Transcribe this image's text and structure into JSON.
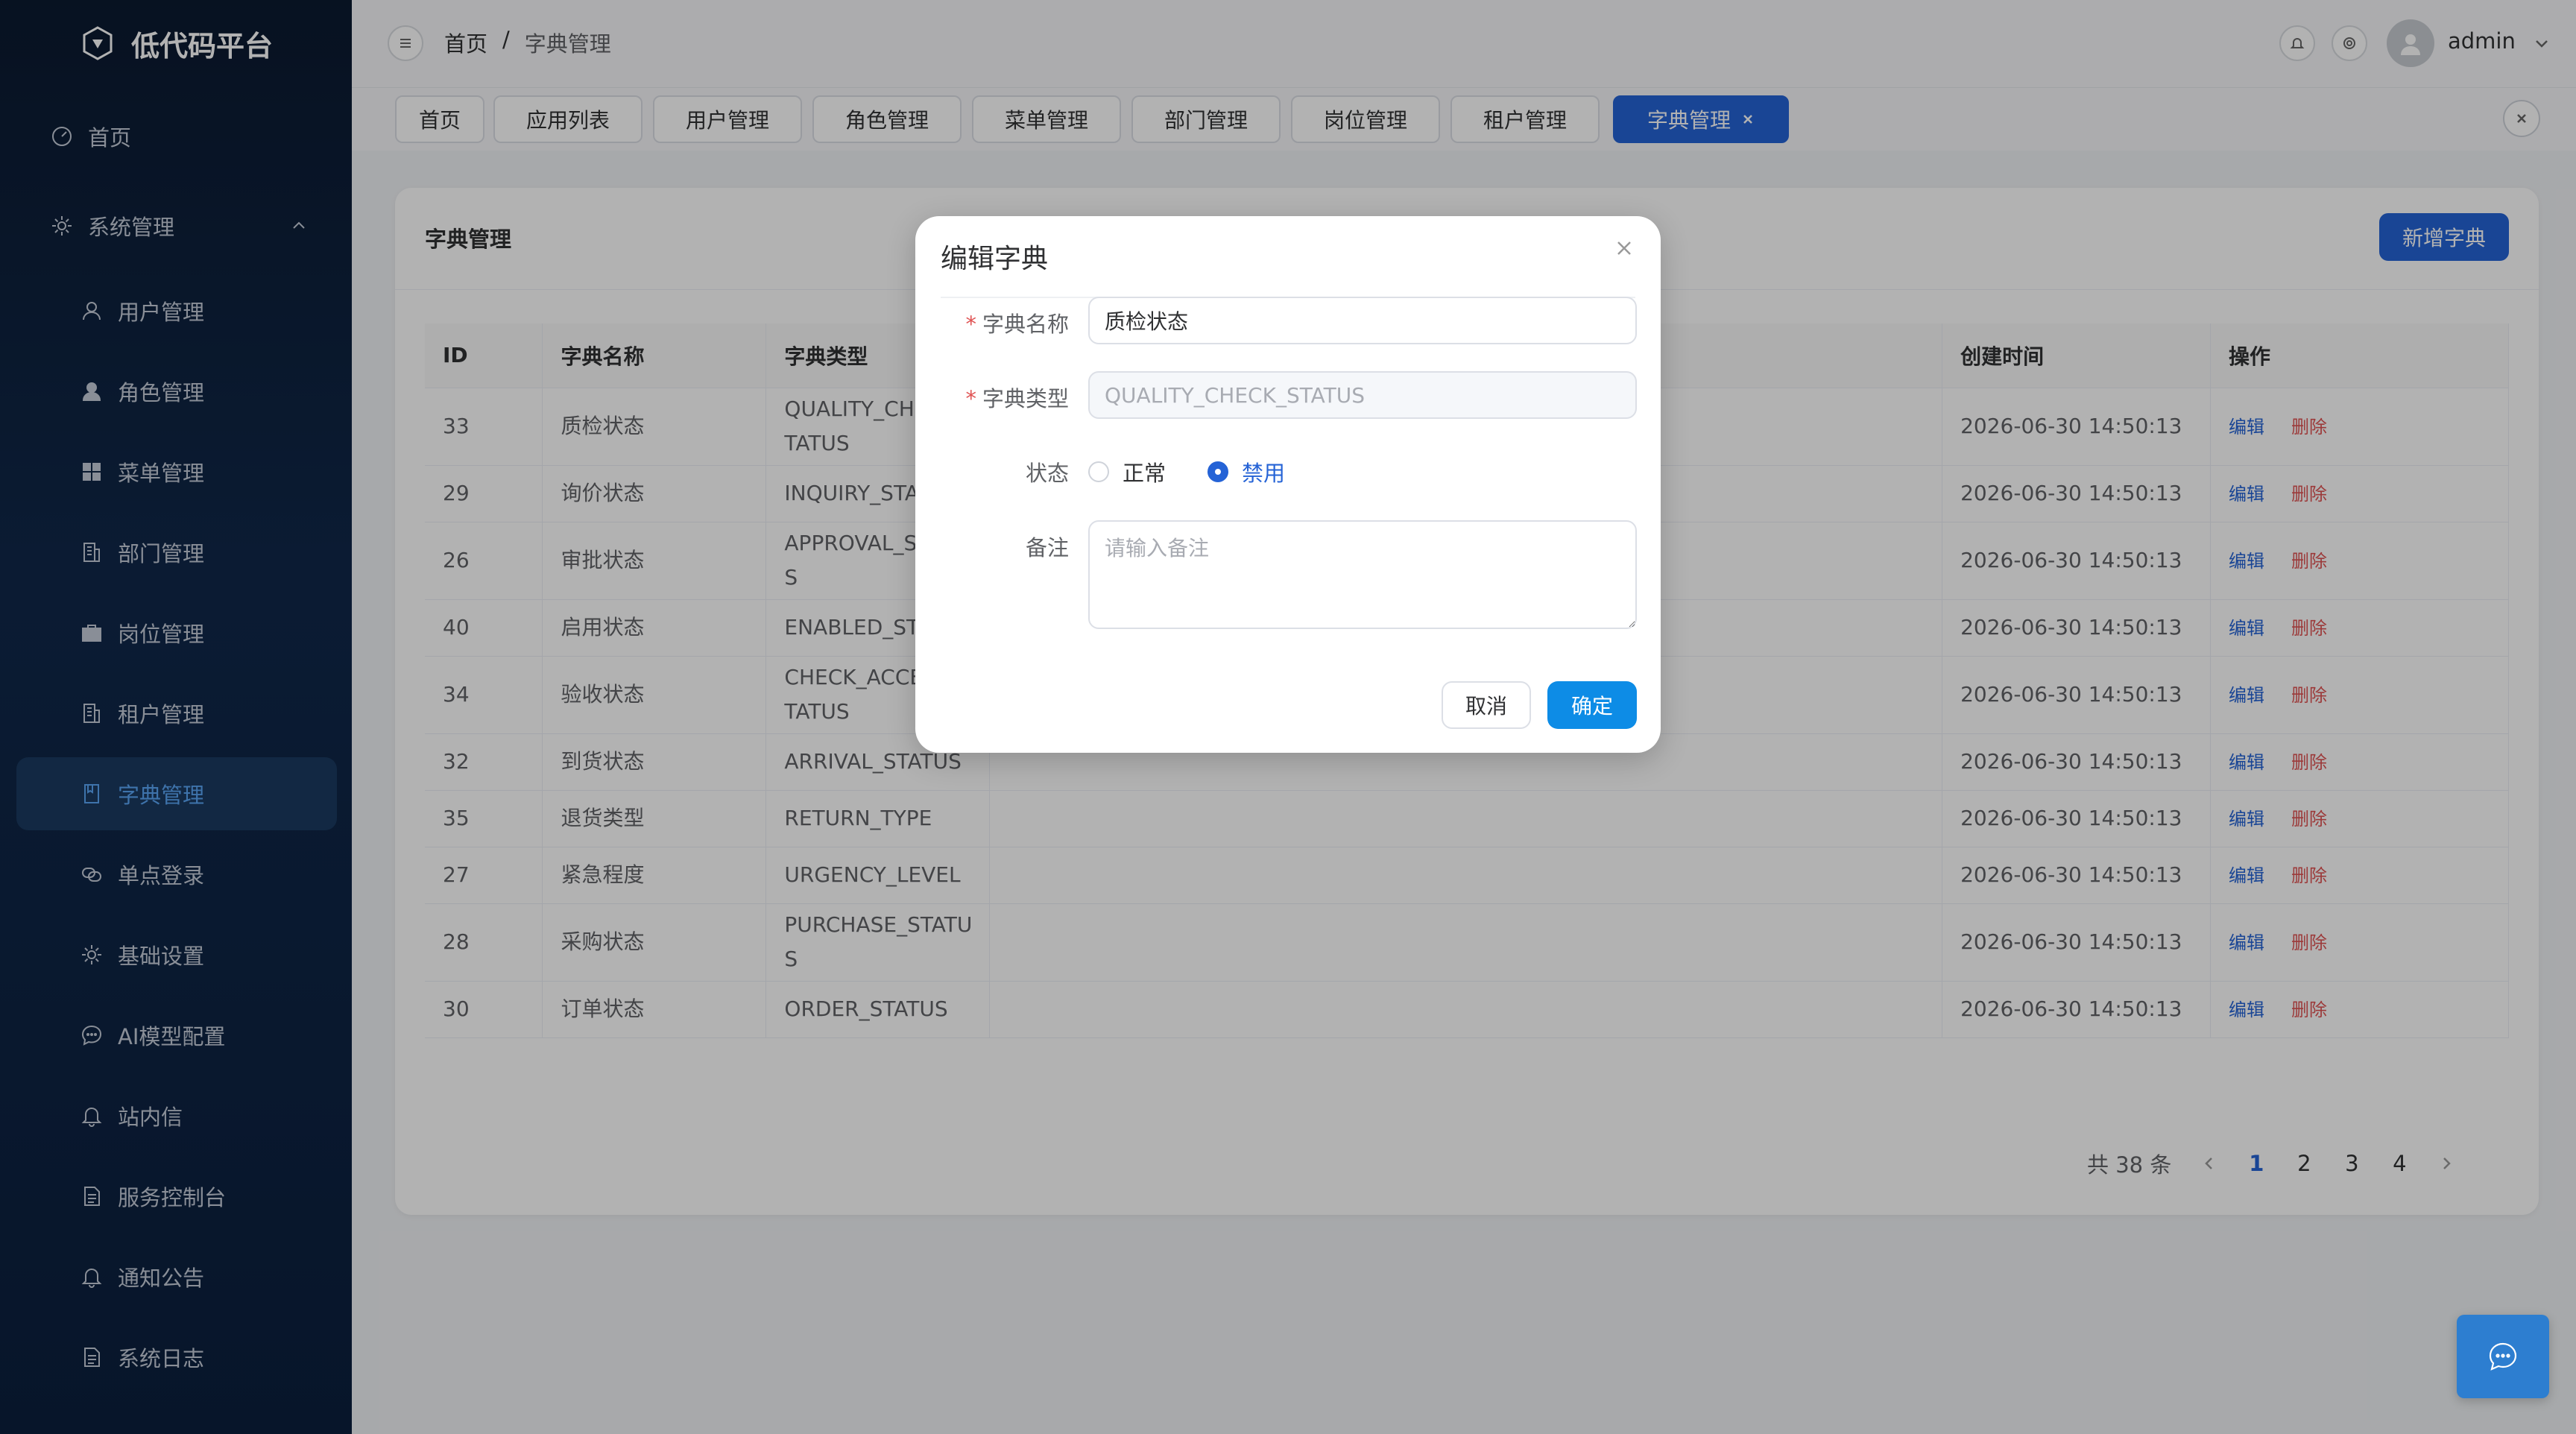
{
  "app": {
    "title": "低代码平台"
  },
  "sidebar": {
    "items": [
      {
        "label": "首页",
        "icon": "dashboard-icon"
      },
      {
        "label": "系统管理",
        "icon": "gear-icon"
      },
      {
        "label": "用户管理",
        "icon": "user-icon"
      },
      {
        "label": "角色管理",
        "icon": "user-solid-icon"
      },
      {
        "label": "菜单管理",
        "icon": "grid-icon"
      },
      {
        "label": "部门管理",
        "icon": "building-icon"
      },
      {
        "label": "岗位管理",
        "icon": "briefcase-icon"
      },
      {
        "label": "租户管理",
        "icon": "building-icon"
      },
      {
        "label": "字典管理",
        "icon": "book-icon"
      },
      {
        "label": "单点登录",
        "icon": "link-icon"
      },
      {
        "label": "基础设置",
        "icon": "gear-icon"
      },
      {
        "label": "AI模型配置",
        "icon": "chat-icon"
      },
      {
        "label": "站内信",
        "icon": "bell-icon"
      },
      {
        "label": "服务控制台",
        "icon": "document-icon"
      },
      {
        "label": "通知公告",
        "icon": "bell-icon"
      },
      {
        "label": "系统日志",
        "icon": "document-icon"
      }
    ]
  },
  "header": {
    "breadcrumb": {
      "home": "首页",
      "separator": "/",
      "current": "字典管理"
    },
    "username": "admin"
  },
  "tabs": [
    {
      "label": "首页"
    },
    {
      "label": "应用列表"
    },
    {
      "label": "用户管理"
    },
    {
      "label": "角色管理"
    },
    {
      "label": "菜单管理"
    },
    {
      "label": "部门管理"
    },
    {
      "label": "岗位管理"
    },
    {
      "label": "租户管理"
    },
    {
      "label": "字典管理"
    }
  ],
  "card": {
    "title": "字典管理",
    "add_button": "新增字典"
  },
  "table": {
    "headers": {
      "id": "ID",
      "name": "字典名称",
      "type": "字典类型",
      "created": "创建时间",
      "ops": "操作"
    },
    "edit_label": "编辑",
    "delete_label": "删除",
    "rows": [
      {
        "id": "33",
        "name": "质检状态",
        "type": "QUALITY_CHECK_STATUS",
        "created": "2026-06-30 14:50:13"
      },
      {
        "id": "29",
        "name": "询价状态",
        "type": "INQUIRY_STATUS",
        "created": "2026-06-30 14:50:13"
      },
      {
        "id": "26",
        "name": "审批状态",
        "type": "APPROVAL_STATUS",
        "created": "2026-06-30 14:50:13"
      },
      {
        "id": "40",
        "name": "启用状态",
        "type": "ENABLED_STATUS",
        "created": "2026-06-30 14:50:13"
      },
      {
        "id": "34",
        "name": "验收状态",
        "type": "CHECK_ACCEPT_STATUS",
        "created": "2026-06-30 14:50:13"
      },
      {
        "id": "32",
        "name": "到货状态",
        "type": "ARRIVAL_STATUS",
        "created": "2026-06-30 14:50:13"
      },
      {
        "id": "35",
        "name": "退货类型",
        "type": "RETURN_TYPE",
        "created": "2026-06-30 14:50:13"
      },
      {
        "id": "27",
        "name": "紧急程度",
        "type": "URGENCY_LEVEL",
        "created": "2026-06-30 14:50:13"
      },
      {
        "id": "28",
        "name": "采购状态",
        "type": "PURCHASE_STATUS",
        "created": "2026-06-30 14:50:13"
      },
      {
        "id": "30",
        "name": "订单状态",
        "type": "ORDER_STATUS",
        "created": "2026-06-30 14:50:13"
      }
    ]
  },
  "pagination": {
    "total": "共 38 条",
    "pages": [
      "1",
      "2",
      "3",
      "4"
    ],
    "current": "1"
  },
  "dialog": {
    "title": "编辑字典",
    "name_label": "字典名称",
    "name_value": "质检状态",
    "type_label": "字典类型",
    "type_value": "QUALITY_CHECK_STATUS",
    "status_label": "状态",
    "status_options": [
      "正常",
      "禁用"
    ],
    "status_selected": "禁用",
    "remark_label": "备注",
    "remark_placeholder": "请输入备注",
    "cancel": "取消",
    "confirm": "确定"
  },
  "colors": {
    "accent": "#2563d6",
    "danger": "#e05454",
    "sidebar_bg": "#0b1a30"
  }
}
